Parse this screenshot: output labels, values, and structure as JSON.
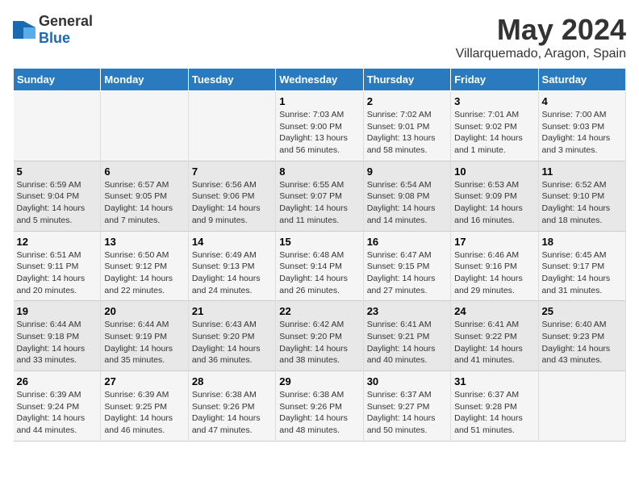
{
  "header": {
    "logo_general": "General",
    "logo_blue": "Blue",
    "title": "May 2024",
    "subtitle": "Villarquemado, Aragon, Spain"
  },
  "days_of_week": [
    "Sunday",
    "Monday",
    "Tuesday",
    "Wednesday",
    "Thursday",
    "Friday",
    "Saturday"
  ],
  "weeks": [
    [
      {
        "day": "",
        "info": ""
      },
      {
        "day": "",
        "info": ""
      },
      {
        "day": "",
        "info": ""
      },
      {
        "day": "1",
        "info": "Sunrise: 7:03 AM\nSunset: 9:00 PM\nDaylight: 13 hours and 56 minutes."
      },
      {
        "day": "2",
        "info": "Sunrise: 7:02 AM\nSunset: 9:01 PM\nDaylight: 13 hours and 58 minutes."
      },
      {
        "day": "3",
        "info": "Sunrise: 7:01 AM\nSunset: 9:02 PM\nDaylight: 14 hours and 1 minute."
      },
      {
        "day": "4",
        "info": "Sunrise: 7:00 AM\nSunset: 9:03 PM\nDaylight: 14 hours and 3 minutes."
      }
    ],
    [
      {
        "day": "5",
        "info": "Sunrise: 6:59 AM\nSunset: 9:04 PM\nDaylight: 14 hours and 5 minutes."
      },
      {
        "day": "6",
        "info": "Sunrise: 6:57 AM\nSunset: 9:05 PM\nDaylight: 14 hours and 7 minutes."
      },
      {
        "day": "7",
        "info": "Sunrise: 6:56 AM\nSunset: 9:06 PM\nDaylight: 14 hours and 9 minutes."
      },
      {
        "day": "8",
        "info": "Sunrise: 6:55 AM\nSunset: 9:07 PM\nDaylight: 14 hours and 11 minutes."
      },
      {
        "day": "9",
        "info": "Sunrise: 6:54 AM\nSunset: 9:08 PM\nDaylight: 14 hours and 14 minutes."
      },
      {
        "day": "10",
        "info": "Sunrise: 6:53 AM\nSunset: 9:09 PM\nDaylight: 14 hours and 16 minutes."
      },
      {
        "day": "11",
        "info": "Sunrise: 6:52 AM\nSunset: 9:10 PM\nDaylight: 14 hours and 18 minutes."
      }
    ],
    [
      {
        "day": "12",
        "info": "Sunrise: 6:51 AM\nSunset: 9:11 PM\nDaylight: 14 hours and 20 minutes."
      },
      {
        "day": "13",
        "info": "Sunrise: 6:50 AM\nSunset: 9:12 PM\nDaylight: 14 hours and 22 minutes."
      },
      {
        "day": "14",
        "info": "Sunrise: 6:49 AM\nSunset: 9:13 PM\nDaylight: 14 hours and 24 minutes."
      },
      {
        "day": "15",
        "info": "Sunrise: 6:48 AM\nSunset: 9:14 PM\nDaylight: 14 hours and 26 minutes."
      },
      {
        "day": "16",
        "info": "Sunrise: 6:47 AM\nSunset: 9:15 PM\nDaylight: 14 hours and 27 minutes."
      },
      {
        "day": "17",
        "info": "Sunrise: 6:46 AM\nSunset: 9:16 PM\nDaylight: 14 hours and 29 minutes."
      },
      {
        "day": "18",
        "info": "Sunrise: 6:45 AM\nSunset: 9:17 PM\nDaylight: 14 hours and 31 minutes."
      }
    ],
    [
      {
        "day": "19",
        "info": "Sunrise: 6:44 AM\nSunset: 9:18 PM\nDaylight: 14 hours and 33 minutes."
      },
      {
        "day": "20",
        "info": "Sunrise: 6:44 AM\nSunset: 9:19 PM\nDaylight: 14 hours and 35 minutes."
      },
      {
        "day": "21",
        "info": "Sunrise: 6:43 AM\nSunset: 9:20 PM\nDaylight: 14 hours and 36 minutes."
      },
      {
        "day": "22",
        "info": "Sunrise: 6:42 AM\nSunset: 9:20 PM\nDaylight: 14 hours and 38 minutes."
      },
      {
        "day": "23",
        "info": "Sunrise: 6:41 AM\nSunset: 9:21 PM\nDaylight: 14 hours and 40 minutes."
      },
      {
        "day": "24",
        "info": "Sunrise: 6:41 AM\nSunset: 9:22 PM\nDaylight: 14 hours and 41 minutes."
      },
      {
        "day": "25",
        "info": "Sunrise: 6:40 AM\nSunset: 9:23 PM\nDaylight: 14 hours and 43 minutes."
      }
    ],
    [
      {
        "day": "26",
        "info": "Sunrise: 6:39 AM\nSunset: 9:24 PM\nDaylight: 14 hours and 44 minutes."
      },
      {
        "day": "27",
        "info": "Sunrise: 6:39 AM\nSunset: 9:25 PM\nDaylight: 14 hours and 46 minutes."
      },
      {
        "day": "28",
        "info": "Sunrise: 6:38 AM\nSunset: 9:26 PM\nDaylight: 14 hours and 47 minutes."
      },
      {
        "day": "29",
        "info": "Sunrise: 6:38 AM\nSunset: 9:26 PM\nDaylight: 14 hours and 48 minutes."
      },
      {
        "day": "30",
        "info": "Sunrise: 6:37 AM\nSunset: 9:27 PM\nDaylight: 14 hours and 50 minutes."
      },
      {
        "day": "31",
        "info": "Sunrise: 6:37 AM\nSunset: 9:28 PM\nDaylight: 14 hours and 51 minutes."
      },
      {
        "day": "",
        "info": ""
      }
    ]
  ]
}
